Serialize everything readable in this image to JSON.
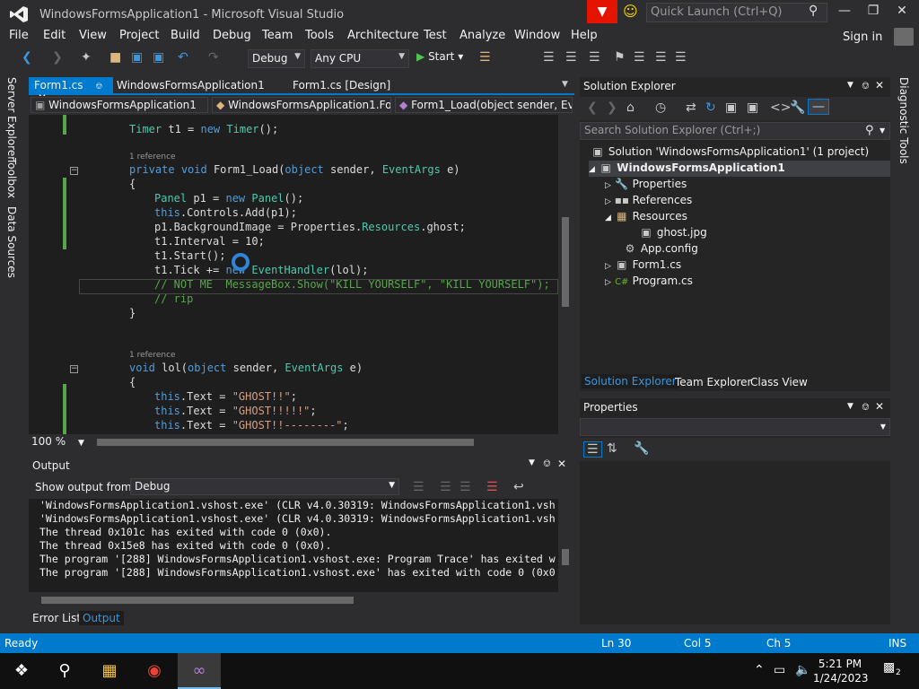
{
  "window": {
    "title": "WindowsFormsApplication1 - Microsoft Visual Studio",
    "quick_launch_placeholder": "Quick Launch (Ctrl+Q)"
  },
  "menu": [
    "File",
    "Edit",
    "View",
    "Project",
    "Build",
    "Debug",
    "Team",
    "Tools",
    "Architecture",
    "Test",
    "Analyze",
    "Window",
    "Help"
  ],
  "sign_in": "Sign in",
  "toolbar": {
    "config": "Debug",
    "platform": "Any CPU",
    "start": "Start"
  },
  "tabs": [
    {
      "label": "Form1.cs",
      "active": true
    },
    {
      "label": "WindowsFormsApplication1"
    },
    {
      "label": "Form1.cs [Design]"
    }
  ],
  "navbar": {
    "project": "WindowsFormsApplication1",
    "class": "WindowsFormsApplication1.Fo",
    "member": "Form1_Load(object sender, Eve"
  },
  "side_tabs": [
    "Server Explorer",
    "Toolbox",
    "Data Sources"
  ],
  "editor": {
    "zoom": "100 %",
    "reference_label": "1 reference",
    "lines": {
      "l1": [
        "",
        "Timer",
        " t1 = ",
        "new",
        " ",
        "Timer",
        "();"
      ],
      "l3_kw1": "private",
      "l3_kw2": "void",
      "l3_name": " Form1_Load(",
      "l3_kw3": "object",
      "l3_mid": " sender, ",
      "l3_ty": "EventArgs",
      "l3_end": " e)",
      "brace_open": "{",
      "brace_close": "}",
      "p1": {
        "ty": "Panel",
        "mid": " p1 = ",
        "kw": "new",
        "ty2": "Panel",
        "end": "();"
      },
      "p2": {
        "kw": "this",
        "end": ".Controls.Add(p1);"
      },
      "p3": {
        "a": "p1.BackgroundImage = Properties.",
        "ty": "Resources",
        "b": ".ghost;"
      },
      "p4": "t1.Interval = 10;",
      "p5": "t1.Start();",
      "p6": {
        "a": "t1.Tick += ",
        "kw": "new",
        "ty": "EventHandler",
        "b": "(lol);"
      },
      "c1": "// NOT ME  MessageBox.Show(\"KILL YOURSELF\", \"KILL YOURSELF\");",
      "c2": "// rip",
      "lol_kw": "void",
      "lol_name": " lol(",
      "lol_kw2": "object",
      "lol_mid": " sender, ",
      "lol_ty": "EventArgs",
      "lol_end": " e)",
      "t1": {
        "kw": "this",
        "a": ".Text = ",
        "st": "\"GHOST!!\"",
        "b": ";"
      },
      "t2": {
        "kw": "this",
        "a": ".Text = ",
        "st": "\"GHOST!!!!!\"",
        "b": ";"
      },
      "t3": {
        "kw": "this",
        "a": ".Text = ",
        "st": "\"GHOST!!--------\"",
        "b": ";"
      }
    }
  },
  "output": {
    "title": "Output",
    "show_from_label": "Show output from:",
    "show_from_value": "Debug",
    "lines": [
      "'WindowsFormsApplication1.vshost.exe' (CLR v4.0.30319: WindowsFormsApplication1.vsh",
      "'WindowsFormsApplication1.vshost.exe' (CLR v4.0.30319: WindowsFormsApplication1.vsh",
      "The thread 0x101c has exited with code 0 (0x0).",
      "The thread 0x15e8 has exited with code 0 (0x0).",
      "The program '[288] WindowsFormsApplication1.vshost.exe: Program Trace' has exited w",
      "The program '[288] WindowsFormsApplication1.vshost.exe' has exited with code 0 (0x0"
    ],
    "tabs": [
      "Error List",
      "Output"
    ]
  },
  "solution_explorer": {
    "title": "Solution Explorer",
    "search_placeholder": "Search Solution Explorer (Ctrl+;)",
    "items": [
      {
        "label": "Solution 'WindowsFormsApplication1' (1 project)"
      },
      {
        "label": "WindowsFormsApplication1"
      },
      {
        "label": "Properties"
      },
      {
        "label": "References"
      },
      {
        "label": "Resources"
      },
      {
        "label": "ghost.jpg"
      },
      {
        "label": "App.config"
      },
      {
        "label": "Form1.cs"
      },
      {
        "label": "Program.cs"
      }
    ],
    "tabs": [
      "Solution Explorer",
      "Team Explorer",
      "Class View"
    ]
  },
  "properties": {
    "title": "Properties"
  },
  "diagnostic_tools": "Diagnostic Tools",
  "status": {
    "ready": "Ready",
    "ln": "Ln 30",
    "col": "Col 5",
    "ch": "Ch 5",
    "ins": "INS"
  },
  "taskbar": {
    "time": "5:21 PM",
    "date": "1/24/2023",
    "notifications": "2"
  }
}
